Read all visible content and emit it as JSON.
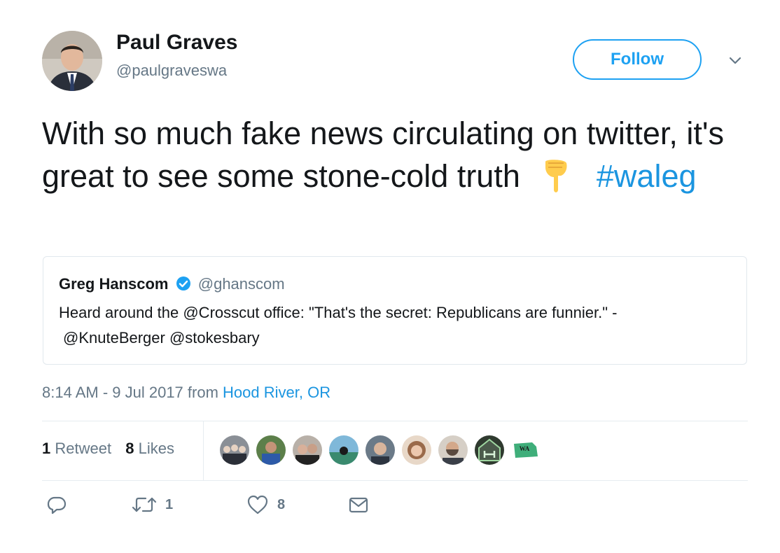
{
  "author": {
    "name": "Paul Graves",
    "handle": "@paulgraveswa",
    "avatar_icon": "profile-photo"
  },
  "follow_label": "Follow",
  "tweet": {
    "text": "With so much fake news circulating on twitter, it's great to see some stone-cold truth",
    "emoji": "backhand-index-pointing-down",
    "hashtag": "#waleg"
  },
  "quoted": {
    "name": "Greg Hanscom",
    "verified": true,
    "handle": "@ghanscom",
    "text_line1": "Heard around the @Crosscut office: \"That's the secret: Republicans are funnier.\" -",
    "text_line2": "@KnuteBerger @stokesbary"
  },
  "meta": {
    "time": "8:14 AM - 9 Jul 2017 from",
    "location": "Hood River, OR"
  },
  "stats": {
    "retweets_count": "1",
    "retweets_label": "Retweet",
    "likes_count": "8",
    "likes_label": "Likes"
  },
  "likers": [
    {
      "icon": "liker-avatar-group-photo",
      "color": "#8a8f96"
    },
    {
      "icon": "liker-avatar-person",
      "color": "#3b5f9e"
    },
    {
      "icon": "liker-avatar-couple",
      "color": "#7a6a5c"
    },
    {
      "icon": "liker-avatar-outdoor",
      "color": "#3a8a6e"
    },
    {
      "icon": "liker-avatar-man",
      "color": "#6b7a88"
    },
    {
      "icon": "liker-avatar-woman",
      "color": "#c99e7c"
    },
    {
      "icon": "liker-avatar-bearded-man",
      "color": "#5a4a40"
    },
    {
      "icon": "liker-avatar-house-logo",
      "color": "#4b5a4b"
    },
    {
      "icon": "liker-avatar-wa-legislators-logo",
      "color": "#3fae7a"
    }
  ],
  "actions": {
    "reply_icon": "reply-icon",
    "retweet_count": "1",
    "like_count": "8",
    "dm_icon": "envelope-icon"
  },
  "colors": {
    "accent": "#1da1f2",
    "link": "#1b95e0",
    "secondary_text": "#657786",
    "border": "#e1e8ed"
  }
}
